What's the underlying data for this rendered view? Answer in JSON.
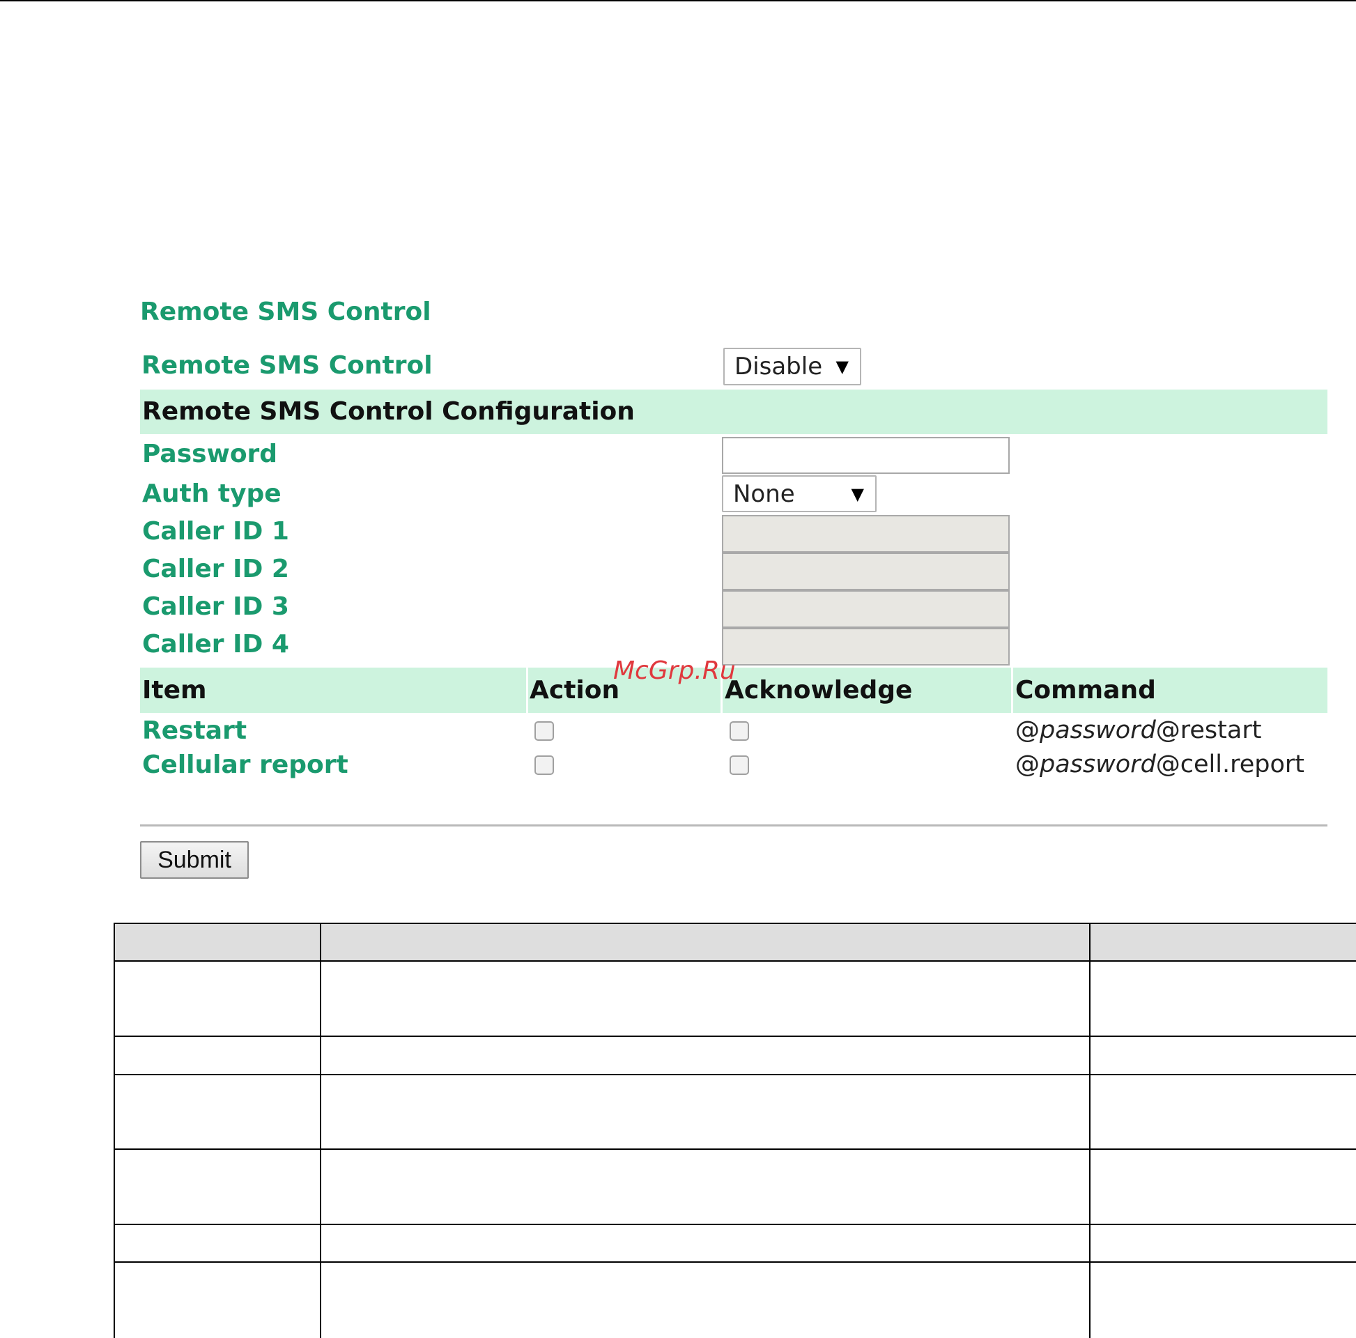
{
  "section_title": "Remote SMS Control",
  "remote_sms": {
    "label": "Remote SMS Control",
    "selected": "Disable",
    "arrow": "▼"
  },
  "config_header": "Remote SMS Control Configuration",
  "fields": {
    "password_label": "Password",
    "password_value": "",
    "auth_label": "Auth type",
    "auth_selected": "None",
    "auth_arrow": "▼",
    "caller_ids": [
      {
        "label": "Caller ID 1",
        "value": ""
      },
      {
        "label": "Caller ID 2",
        "value": ""
      },
      {
        "label": "Caller ID 3",
        "value": ""
      },
      {
        "label": "Caller ID 4",
        "value": ""
      }
    ]
  },
  "commands_table": {
    "headers": {
      "item": "Item",
      "action": "Action",
      "acknowledge": "Acknowledge",
      "command": "Command"
    },
    "rows": [
      {
        "item": "Restart",
        "action": false,
        "acknowledge": false,
        "cmd_prefix": "@",
        "cmd_italic": "password",
        "cmd_suffix": "@restart"
      },
      {
        "item": "Cellular report",
        "action": false,
        "acknowledge": false,
        "cmd_prefix": "@",
        "cmd_italic": "password",
        "cmd_suffix": "@cell.report"
      }
    ]
  },
  "submit_label": "Submit",
  "watermark": "McGrp.Ru"
}
